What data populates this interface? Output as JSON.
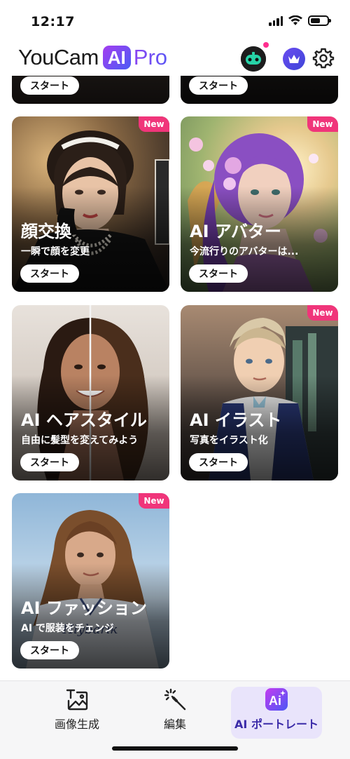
{
  "status_bar": {
    "time": "12:17"
  },
  "header": {
    "logo_text": "YouCam",
    "logo_ai": "AI",
    "logo_pro": "Pro"
  },
  "cards_top": [
    {
      "start_label": "スタート"
    },
    {
      "start_label": "スタート"
    }
  ],
  "cards": [
    {
      "title": "顔交換",
      "subtitle": "一瞬で顔を変更",
      "start_label": "スタート",
      "badge": "New"
    },
    {
      "title": "AI アバター",
      "subtitle": "今流行りのアバターは...",
      "start_label": "スタート",
      "badge": "New"
    },
    {
      "title": "AI ヘアスタイル",
      "subtitle": "自由に髪型を変えてみよう",
      "start_label": "スタート",
      "badge": ""
    },
    {
      "title": "AI イラスト",
      "subtitle": "写真をイラスト化",
      "start_label": "スタート",
      "badge": "New"
    },
    {
      "title": "AI ファッション",
      "subtitle": "AI で服装をチェンジ",
      "start_label": "スタート",
      "badge": "New"
    }
  ],
  "tabs": [
    {
      "label": "画像生成",
      "icon": "image-generate-icon",
      "active": false
    },
    {
      "label": "編集",
      "icon": "magic-wand-icon",
      "active": false
    },
    {
      "label": "AI ポートレート",
      "icon": "ai-portrait-icon",
      "active": true
    }
  ],
  "colors": {
    "badge": "#f0357a",
    "accent": "#5a4cf0",
    "active_tab_bg": "#e9e4fb"
  }
}
